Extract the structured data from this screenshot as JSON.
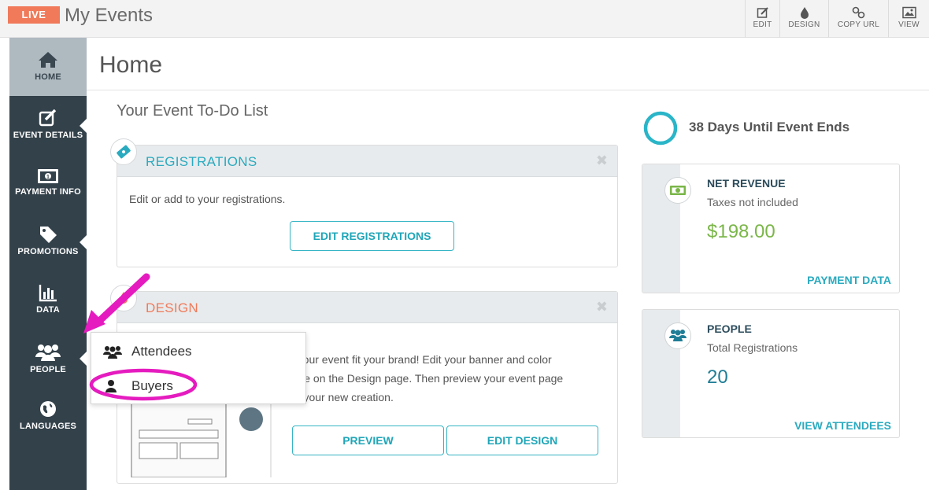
{
  "topbar": {
    "live_label": "LIVE",
    "title": "My Events",
    "actions": [
      {
        "label": "EDIT",
        "icon": "edit-icon"
      },
      {
        "label": "DESIGN",
        "icon": "drop-icon"
      },
      {
        "label": "COPY URL",
        "icon": "link-icon"
      },
      {
        "label": "VIEW",
        "icon": "image-icon"
      }
    ]
  },
  "sidebar": {
    "items": [
      {
        "label": "HOME",
        "icon": "home-icon",
        "active": true
      },
      {
        "label": "EVENT DETAILS",
        "icon": "edit-icon"
      },
      {
        "label": "PAYMENT INFO",
        "icon": "money-icon"
      },
      {
        "label": "PROMOTIONS",
        "icon": "tag-icon"
      },
      {
        "label": "DATA",
        "icon": "bar-chart-icon"
      },
      {
        "label": "PEOPLE",
        "icon": "people-icon"
      },
      {
        "label": "LANGUAGES",
        "icon": "globe-icon"
      }
    ]
  },
  "main": {
    "page_title": "Home",
    "todo_heading": "Your Event To-Do List",
    "registrations": {
      "title": "REGISTRATIONS",
      "body": "Edit or add to your registrations.",
      "button": "EDIT REGISTRATIONS"
    },
    "design": {
      "title": "DESIGN",
      "body_line1": "ke your event fit your brand! Edit your banner and color",
      "body_line2": "heme on the Design page. Then preview your event page",
      "body_line3": "see your new creation.",
      "preview_button": "PREVIEW",
      "edit_button": "EDIT DESIGN"
    }
  },
  "right": {
    "countdown": "38 Days Until Event Ends",
    "revenue": {
      "title": "NET REVENUE",
      "subtitle": "Taxes not included",
      "amount": "$198.00",
      "link": "PAYMENT DATA"
    },
    "people": {
      "title": "PEOPLE",
      "subtitle": "Total Registrations",
      "count": "20",
      "link": "VIEW ATTENDEES"
    }
  },
  "people_dropdown": {
    "items": [
      "Attendees",
      "Buyers"
    ]
  },
  "colors": {
    "accent": "#2aaabf",
    "live": "#f07a5a",
    "design_title": "#f07a5a",
    "revenue": "#7ab648",
    "sidebar": "#33414a",
    "annotation": "#e51bbf"
  }
}
